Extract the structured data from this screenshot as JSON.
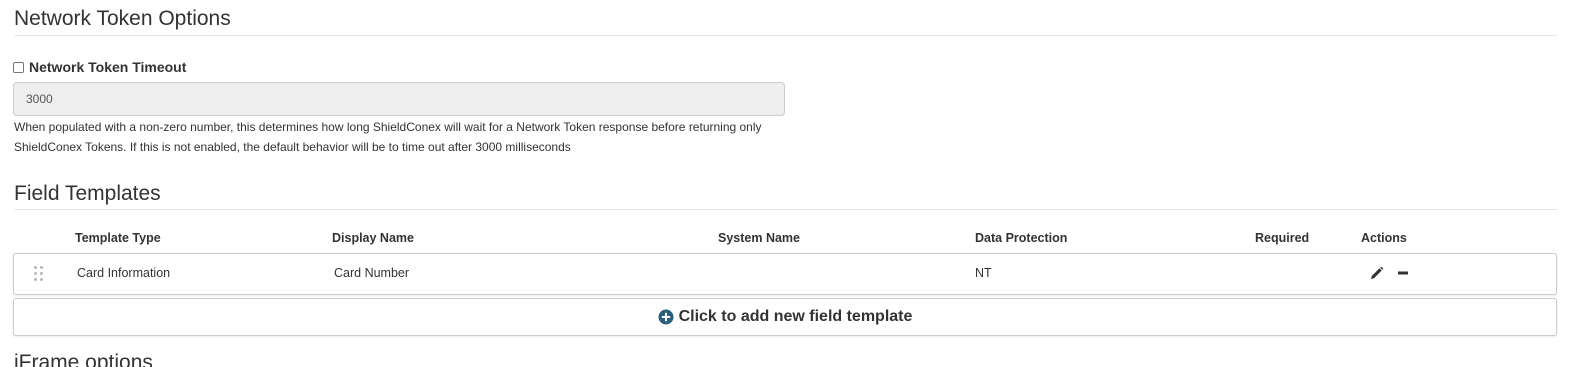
{
  "network_token_options": {
    "title": "Network Token Options",
    "timeout_checkbox_label": "Network Token Timeout",
    "timeout_checked": false,
    "timeout_value": "3000",
    "help_text_line1": "When populated with a non-zero number, this determines how long ShieldConex will wait for a Network Token response before returning only",
    "help_text_line2": "ShieldConex Tokens. If this is not enabled, the default behavior will be to time out after 3000 milliseconds"
  },
  "field_templates": {
    "title": "Field Templates",
    "columns": {
      "template_type": "Template Type",
      "display_name": "Display Name",
      "system_name": "System Name",
      "data_protection": "Data Protection",
      "required": "Required",
      "actions": "Actions"
    },
    "rows": [
      {
        "template_type": "Card Information",
        "display_name": "Card Number",
        "system_name": "",
        "data_protection": "NT",
        "required": "",
        "actions": [
          "pencil-icon",
          "minus-icon"
        ]
      }
    ],
    "add_label": "Click to add new field template",
    "add_icon": "plus-circle-icon",
    "add_icon_color": "#2c5f7c"
  },
  "iframe_options": {
    "title": "iFrame options"
  }
}
